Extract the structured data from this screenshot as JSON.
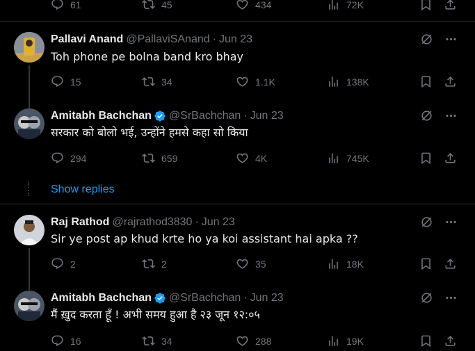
{
  "top_actions": {
    "replies": "61",
    "retweets": "45",
    "likes": "434",
    "views": "72K"
  },
  "tweets": [
    {
      "name": "Pallavi Anand",
      "handle": "@PallaviSAnand",
      "time": "Jun 23",
      "text": "Toh phone pe bolna band kro bhay",
      "replies": "15",
      "retweets": "34",
      "likes": "1.1K",
      "views": "138K",
      "verified": false
    },
    {
      "name": "Amitabh Bachchan",
      "handle": "@SrBachchan",
      "time": "Jun 23",
      "text": "सरकार को बोलो भई, उन्होंने हमसे कहा सो किया",
      "replies": "294",
      "retweets": "659",
      "likes": "4K",
      "views": "745K",
      "verified": true
    },
    {
      "name": "Raj Rathod",
      "handle": "@rajrathod3830",
      "time": "Jun 23",
      "text": "Sir ye post ap khud krte ho ya koi assistant hai apka ??",
      "replies": "2",
      "retweets": "2",
      "likes": "35",
      "views": "18K",
      "verified": false
    },
    {
      "name": "Amitabh Bachchan",
      "handle": "@SrBachchan",
      "time": "Jun 23",
      "text": "मैं ख़ुद करता हूँ ! अभी समय हुआ है २३ जून १२:०५",
      "replies": "16",
      "retweets": "34",
      "likes": "288",
      "views": "19K",
      "verified": true
    }
  ],
  "show_replies": "Show replies",
  "colors": {
    "accent": "#1d9bf0",
    "muted": "#71767b",
    "text": "#e7e9ea",
    "divider": "#2f3336"
  }
}
